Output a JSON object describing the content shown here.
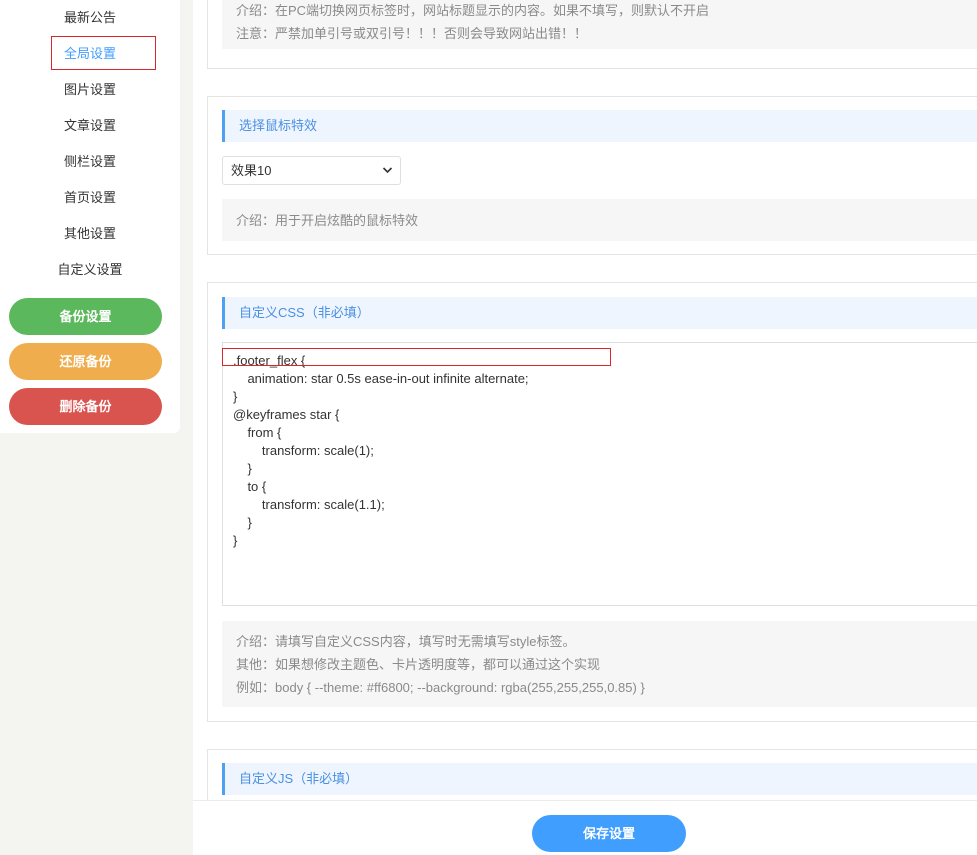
{
  "sidebar": {
    "items": [
      {
        "label": "最新公告"
      },
      {
        "label": "全局设置"
      },
      {
        "label": "图片设置"
      },
      {
        "label": "文章设置"
      },
      {
        "label": "侧栏设置"
      },
      {
        "label": "首页设置"
      },
      {
        "label": "其他设置"
      },
      {
        "label": "自定义设置"
      }
    ],
    "buttons": {
      "backup": "备份设置",
      "restore": "还原备份",
      "delete": "删除备份"
    }
  },
  "sections": {
    "title_switch": {
      "desc_intro": "介绍：在PC端切换网页标签时，网站标题显示的内容。如果不填写，则默认不开启",
      "desc_note": "注意：严禁加单引号或双引号！！！否则会导致网站出错！！"
    },
    "mouse_effect": {
      "title": "选择鼠标特效",
      "selected": "效果10",
      "desc_intro": "介绍：用于开启炫酷的鼠标特效"
    },
    "custom_css": {
      "title": "自定义CSS（非必填）",
      "code_lines": [
        ".footer_flex {",
        "    animation: star 0.5s ease-in-out infinite alternate;",
        "}",
        "@keyframes star {",
        "    from {",
        "        transform: scale(1);",
        "    }",
        "    to {",
        "        transform: scale(1.1);",
        "    }",
        "}"
      ],
      "desc_intro": "介绍：请填写自定义CSS内容，填写时无需填写style标签。",
      "desc_other": "其他：如果想修改主题色、卡片透明度等，都可以通过这个实现",
      "desc_example": "例如：body { --theme: #ff6800; --background: rgba(255,255,255,0.85) }"
    },
    "custom_js": {
      "title": "自定义JS（非必填）"
    }
  },
  "footer": {
    "save_label": "保存设置"
  },
  "colors": {
    "accent": "#409eff",
    "backup_button": "#5cb85c",
    "restore_button": "#f0ad4e",
    "delete_button": "#d9534f",
    "highlight_box": "#d9262c"
  }
}
